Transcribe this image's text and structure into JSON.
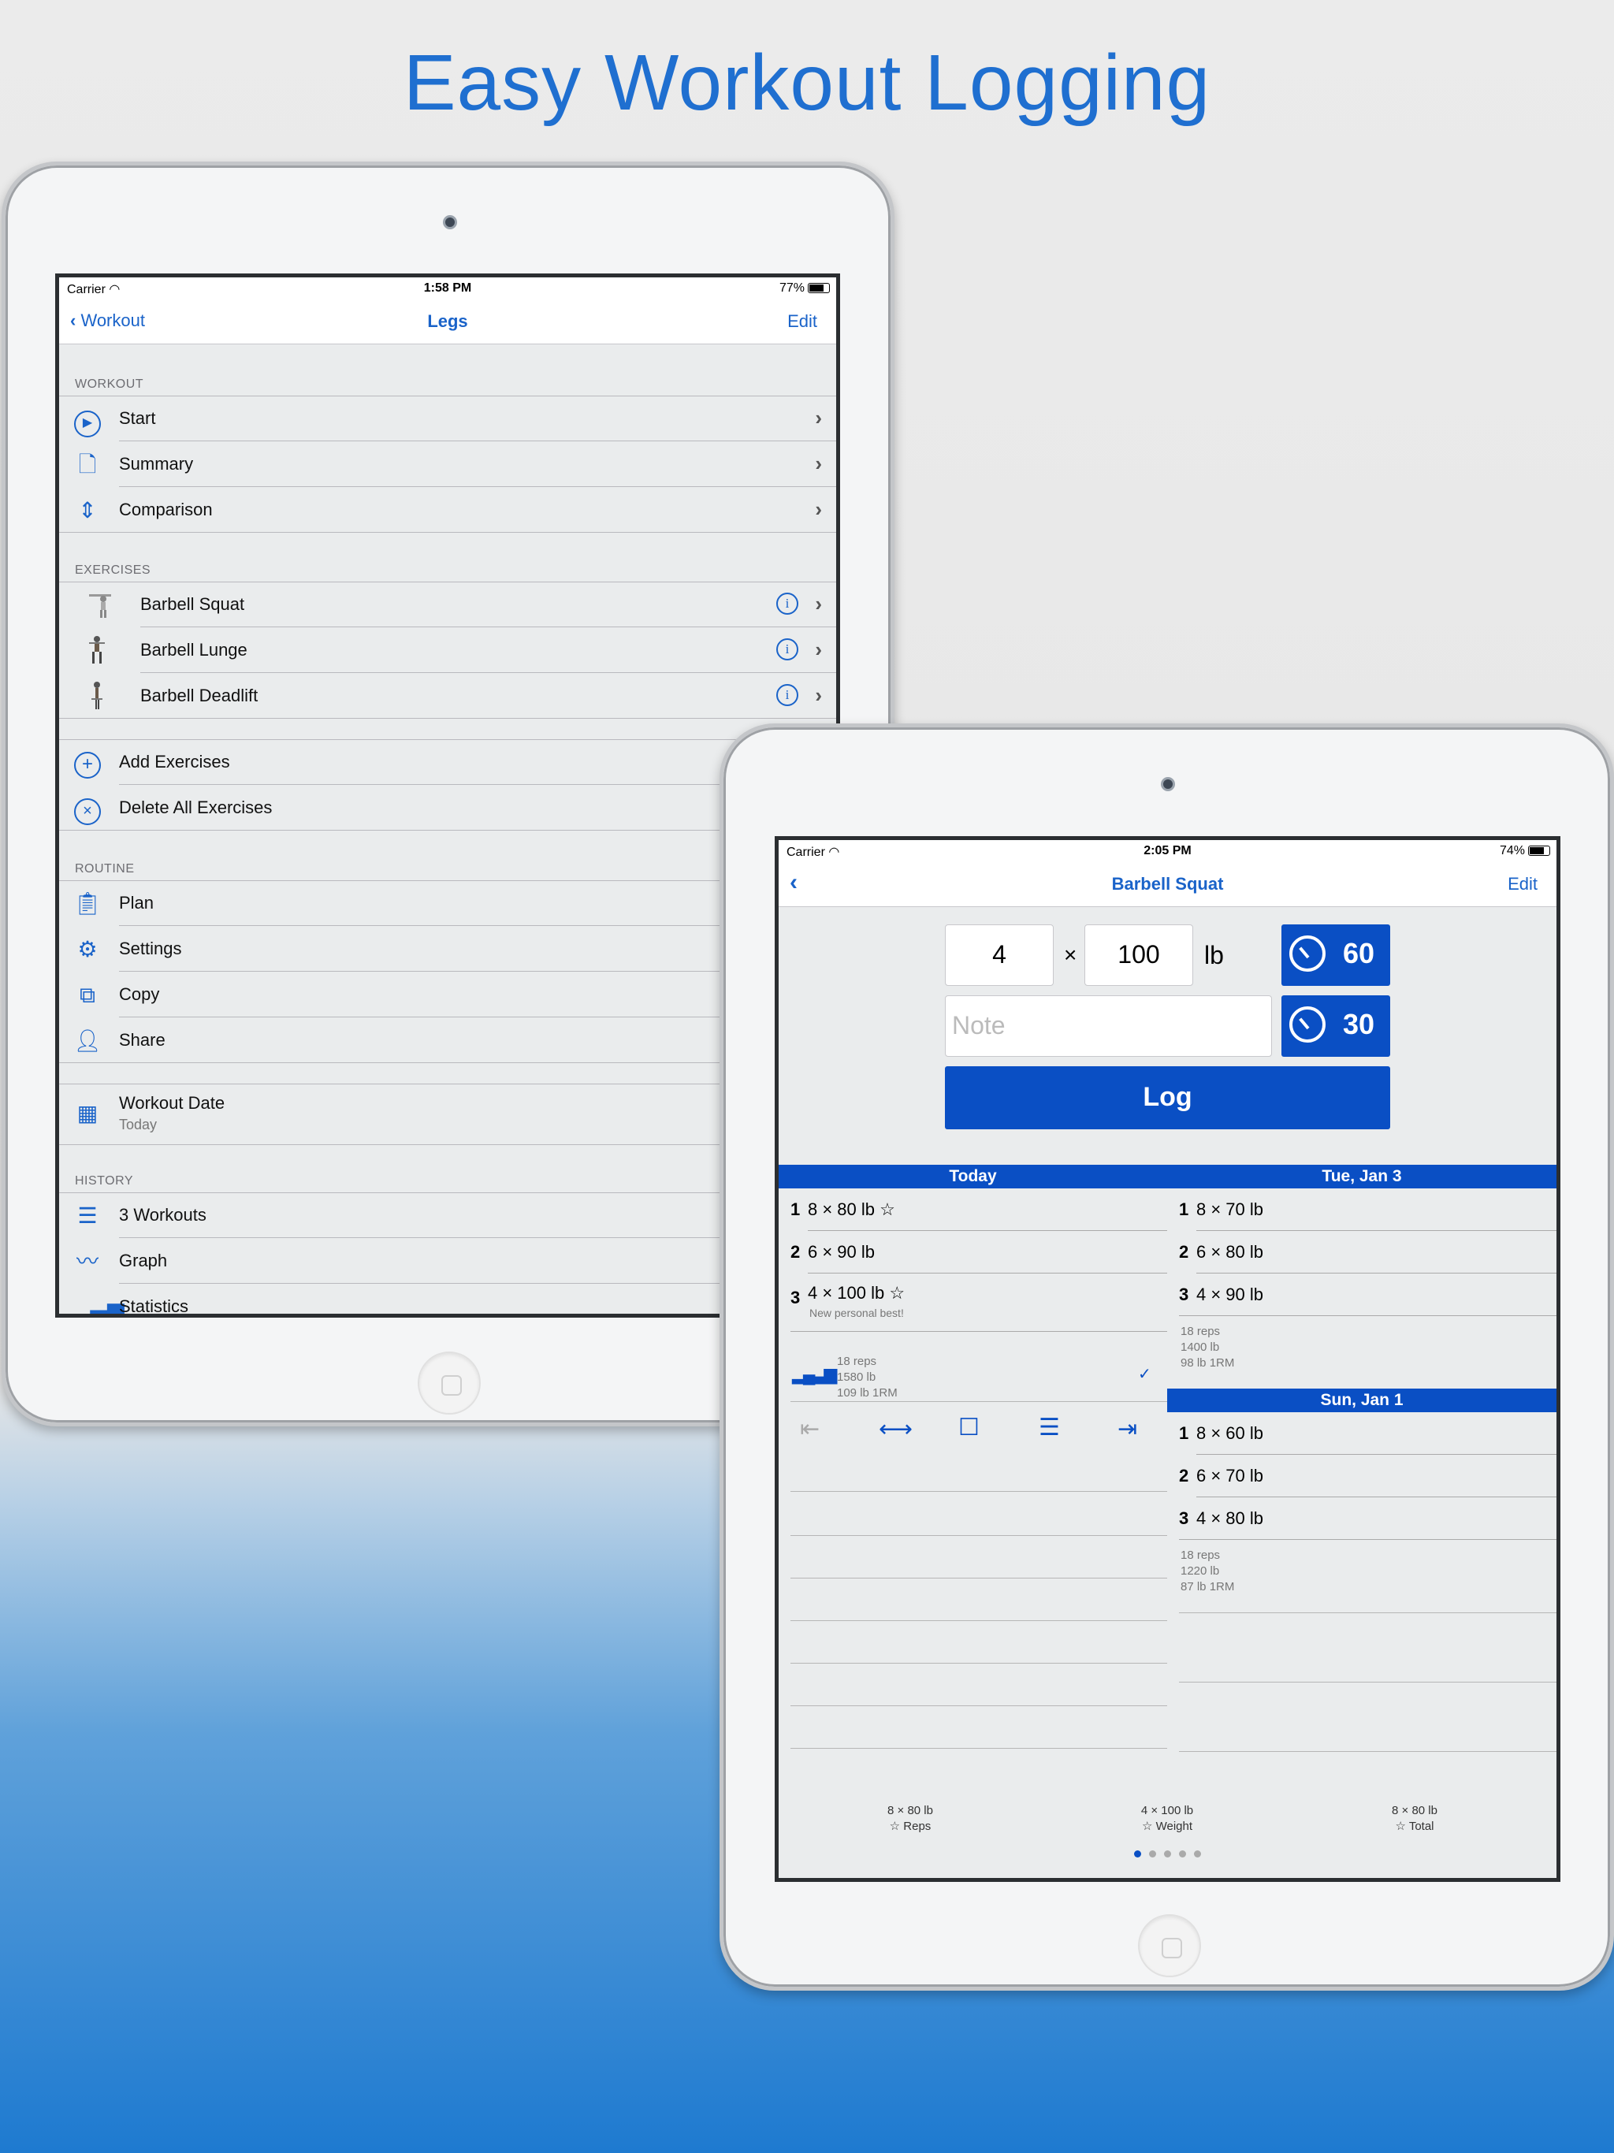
{
  "headline": "Easy Workout Logging",
  "left_ipad": {
    "status": {
      "carrier": "Carrier",
      "time": "1:58 PM",
      "battery": "77%"
    },
    "nav": {
      "back": "Workout",
      "title": "Legs",
      "edit": "Edit"
    },
    "sections": {
      "workout": "WORKOUT",
      "exercises": "EXERCISES",
      "routine": "ROUTINE",
      "history": "HISTORY"
    },
    "workout_rows": [
      "Start",
      "Summary",
      "Comparison"
    ],
    "exercise_rows": [
      "Barbell Squat",
      "Barbell Lunge",
      "Barbell Deadlift"
    ],
    "exercise_actions": [
      "Add Exercises",
      "Delete All Exercises"
    ],
    "routine_rows": [
      "Plan",
      "Settings",
      "Copy",
      "Share"
    ],
    "workout_date": {
      "label": "Workout Date",
      "value": "Today"
    },
    "history_rows": [
      "3 Workouts",
      "Graph",
      "Statistics"
    ]
  },
  "right_ipad": {
    "status": {
      "carrier": "Carrier",
      "time": "2:05 PM",
      "battery": "74%"
    },
    "nav": {
      "title": "Barbell Squat",
      "edit": "Edit"
    },
    "entry": {
      "reps": "4",
      "times": "×",
      "weight": "100",
      "unit": "lb",
      "note_placeholder": "Note",
      "timer1": "60",
      "timer2": "30",
      "log": "Log"
    },
    "today": {
      "header": "Today",
      "sets": [
        {
          "n": "1",
          "v": "8 × 80 lb ☆"
        },
        {
          "n": "2",
          "v": "6 × 90 lb"
        },
        {
          "n": "3",
          "v": "4 × 100 lb ☆",
          "sub": "New personal best!"
        }
      ],
      "summary": [
        "18 reps",
        "1580 lb",
        "109 lb 1RM"
      ],
      "check": "✓"
    },
    "tue": {
      "header": "Tue, Jan 3",
      "sets": [
        {
          "n": "1",
          "v": "8 × 70 lb"
        },
        {
          "n": "2",
          "v": "6 × 80 lb"
        },
        {
          "n": "3",
          "v": "4 × 90 lb"
        }
      ],
      "summary": [
        "18 reps",
        "1400 lb",
        "98 lb 1RM"
      ]
    },
    "sun": {
      "header": "Sun, Jan 1",
      "sets": [
        {
          "n": "1",
          "v": "8 × 60 lb"
        },
        {
          "n": "2",
          "v": "6 × 70 lb"
        },
        {
          "n": "3",
          "v": "4 × 80 lb"
        }
      ],
      "summary": [
        "18 reps",
        "1220 lb",
        "87 lb 1RM"
      ]
    },
    "footer": [
      {
        "top": "8 × 80 lb",
        "bottom": "☆ Reps"
      },
      {
        "top": "4 × 100 lb",
        "bottom": "☆ Weight"
      },
      {
        "top": "8 × 80 lb",
        "bottom": "☆ Total"
      }
    ],
    "page_indicator": {
      "pages": 5,
      "current": 1
    }
  },
  "colors": {
    "accent": "#1a63c9",
    "button": "#0a4fc4",
    "headline": "#1f6fd0"
  }
}
